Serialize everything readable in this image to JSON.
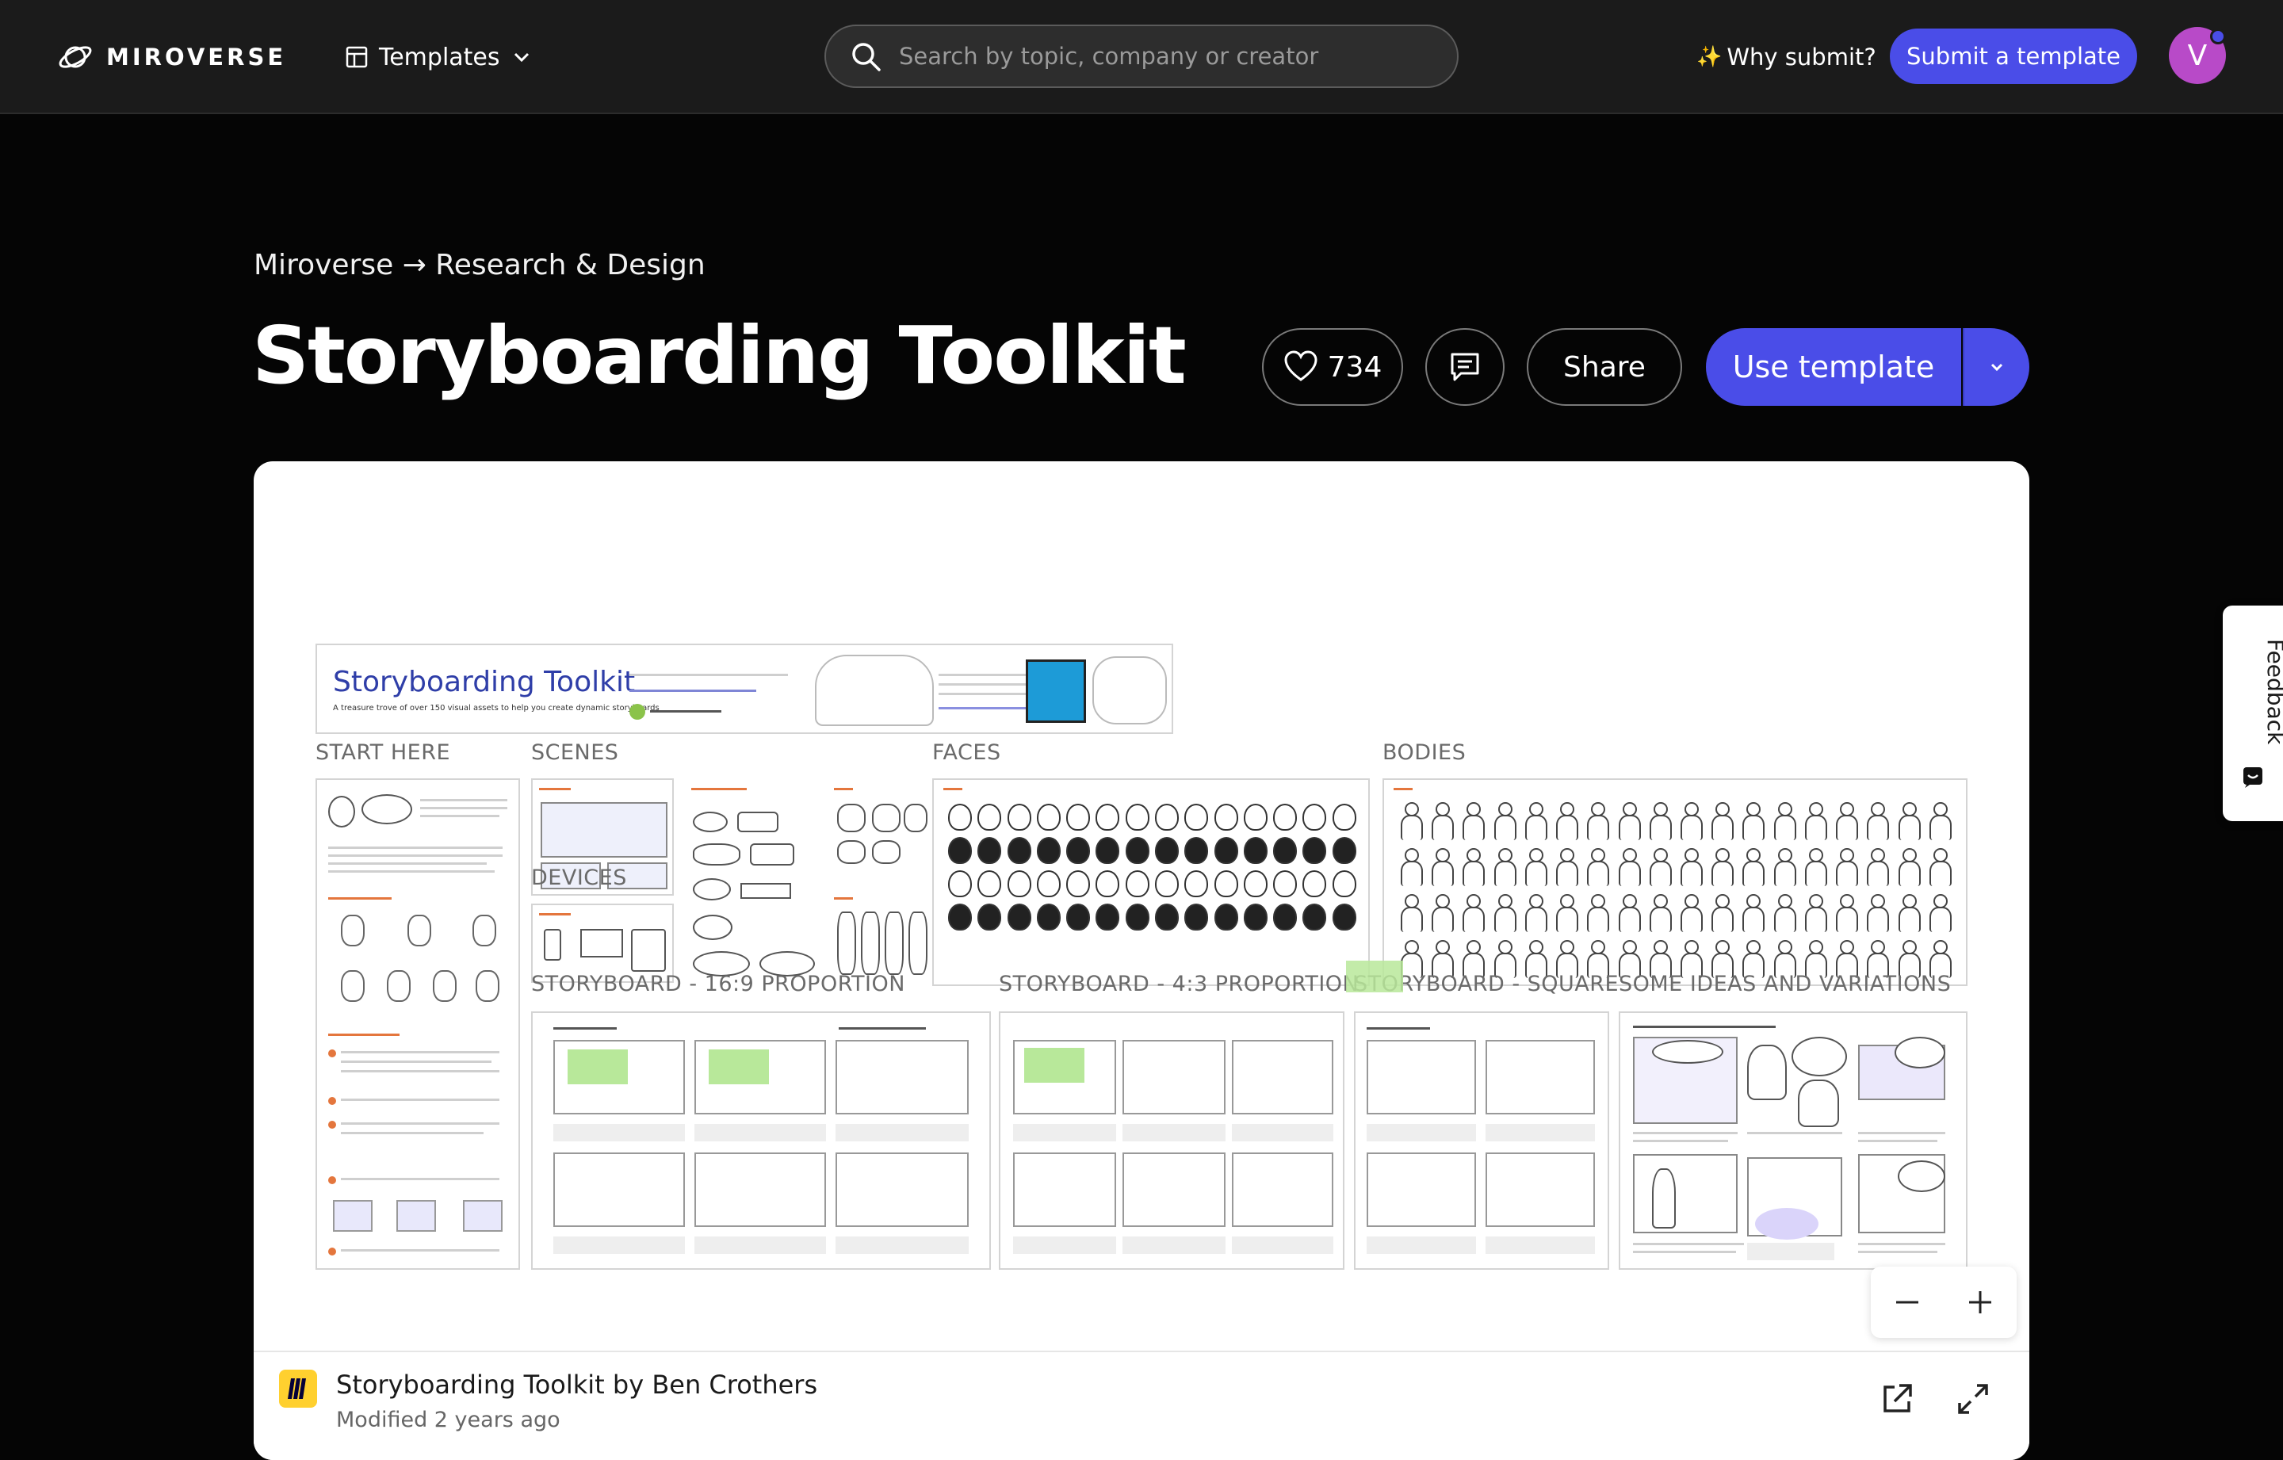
{
  "nav": {
    "brand": "MIROVERSE",
    "templates_label": "Templates",
    "search_placeholder": "Search by topic, company or creator",
    "why_submit_label": "Why submit?",
    "submit_label": "Submit a template",
    "avatar_initial": "V"
  },
  "header": {
    "breadcrumb": "Miroverse → Research & Design",
    "title": "Storyboarding Toolkit",
    "likes": "734",
    "share_label": "Share",
    "use_template_label": "Use template"
  },
  "board": {
    "banner_title": "Storyboarding Toolkit",
    "banner_subtitle": "A treasure trove of over 150 visual assets to help you create dynamic storyboards",
    "sections": {
      "start_here": "START HERE",
      "scenes": "SCENES",
      "faces": "FACES",
      "bodies": "BODIES",
      "devices": "DEVICES",
      "sb_169": "STORYBOARD - 16:9 PROPORTION",
      "sb_43": "STORYBOARD - 4:3 PROPORTION",
      "sb_square": "STORYBOARD - SQUARE",
      "ideas": "SOME IDEAS AND VARIATIONS"
    }
  },
  "footer": {
    "title": "Storyboarding Toolkit by Ben Crothers",
    "modified": "Modified 2 years ago"
  },
  "feedback_label": "Feedback",
  "colors": {
    "accent": "#4a4de8",
    "nav_bg": "#1b1b1b",
    "page_bg": "#050505",
    "avatar": "#b84ac8",
    "sticky": "#b8e89a",
    "miro_yellow": "#ffd02f"
  }
}
